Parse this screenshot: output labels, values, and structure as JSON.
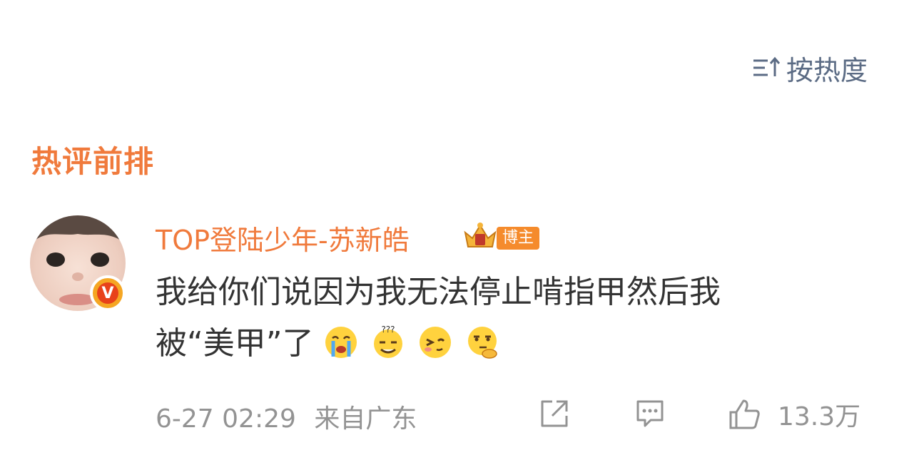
{
  "sort": {
    "label": "按热度",
    "icon": "sort-icon"
  },
  "section": {
    "title": "热评前排"
  },
  "comment": {
    "username": "TOP登陆少年-苏新皓",
    "badge": "博主",
    "line1": "我给你们说因为我无法停止啃指甲然后我",
    "line2": "被“美甲”了",
    "emojis": [
      "crying-emoji",
      "confused-emoji",
      "wink-emoji",
      "thinking-emoji"
    ],
    "verified_letter": "V",
    "time": "6-27 02:29",
    "location": "来自广东",
    "likes": "13.3万"
  },
  "colors": {
    "accent": "#f07a3c",
    "sort": "#5b6b84",
    "meta": "#939393",
    "text": "#333333"
  }
}
